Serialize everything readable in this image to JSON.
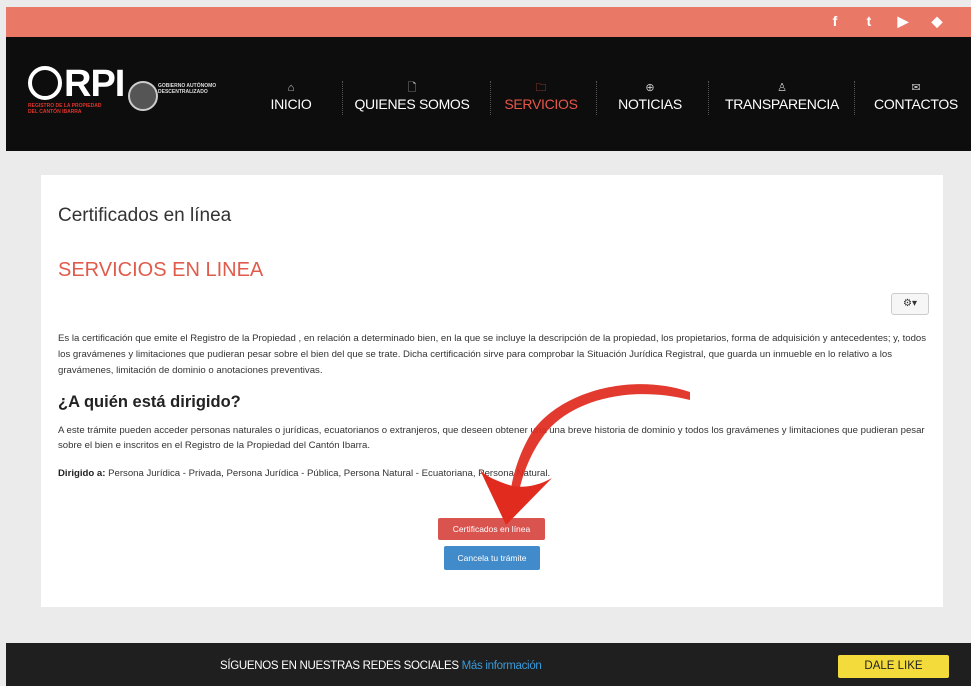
{
  "social": {
    "icons": [
      {
        "name": "facebook-icon",
        "glyph": "f"
      },
      {
        "name": "twitter-icon",
        "glyph": "t"
      },
      {
        "name": "youtube-icon",
        "glyph": "▶"
      },
      {
        "name": "foursquare-icon",
        "glyph": "◆"
      }
    ]
  },
  "logo": {
    "text": "RPI",
    "subtitle": "REGISTRO DE LA PROPIEDAD DEL CANTÓN IBARRA",
    "gad_text": "GOBIERNO AUTÓNOMO DESCENTRALIZADO"
  },
  "nav": {
    "items": [
      {
        "label": "INICIO",
        "icon": "⌂"
      },
      {
        "label": "QUIENES SOMOS",
        "icon": "🗋"
      },
      {
        "label": "SERVICIOS",
        "icon": "🗀"
      },
      {
        "label": "NOTICIAS",
        "icon": "⊕"
      },
      {
        "label": "TRANSPARENCIA",
        "icon": "♙"
      },
      {
        "label": "CONTACTOS",
        "icon": "✉"
      }
    ],
    "active": "SERVICIOS"
  },
  "content": {
    "page_title": "Certificados en línea",
    "section_title": "SERVICIOS EN LINEA",
    "gear_label": "⚙▾",
    "description": "Es la certificación que emite el Registro de la Propiedad , en relación a determinado bien, en la que se incluye la descripción de la propiedad, los propietarios, forma de adquisición y antecedentes; y, todos los gravámenes y limitaciones que pudieran pesar sobre el bien del que se trate. Dicha certificación sirve para comprobar la Situación Jurídica Registral, que guarda un inmueble en lo relativo a los gravámenes, limitación de dominio o anotaciones preventivas.",
    "question": "¿A quién está dirigido?",
    "description2": "A este trámite pueden acceder personas naturales o jurídicas, ecuatorianos o extranjeros, que deseen obtener una una breve historia de dominio y todos los gravámenes y limitaciones que pudieran pesar sobre el bien e inscritos en el Registro de la Propiedad del Cantón Ibarra.",
    "directed_label": "Dirigido a:",
    "directed_value": "Persona Jurídica - Privada, Persona Jurídica - Pública, Persona Natural - Ecuatoriana, Persona Natural.",
    "primary_button": "Certificados en línea",
    "secondary_button": "Cancela tu trámite"
  },
  "colors": {
    "topbar": "#ea7867",
    "accent": "#e8564a",
    "arrow": "#e02b1e",
    "primary_button": "#d9534f",
    "secondary_button": "#428bca",
    "like_button": "#f2db3a"
  },
  "footer": {
    "text": "SÍGUENOS EN NUESTRAS REDES SOCIALES",
    "link": "Más información",
    "like_button": "DALE LIKE"
  }
}
